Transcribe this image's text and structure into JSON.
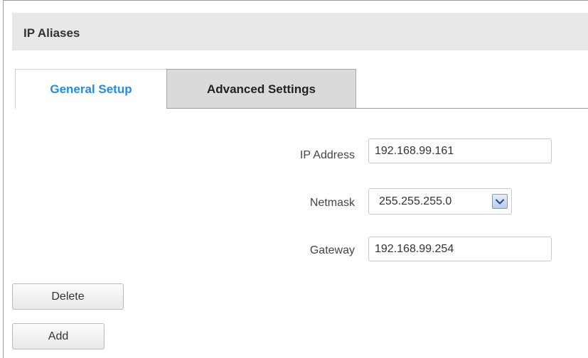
{
  "section": {
    "title": "IP Aliases"
  },
  "tabs": [
    {
      "label": "General Setup",
      "active": true
    },
    {
      "label": "Advanced Settings",
      "active": false
    }
  ],
  "form": {
    "ip_address": {
      "label": "IP Address",
      "value": "192.168.99.161"
    },
    "netmask": {
      "label": "Netmask",
      "value": "255.255.255.0",
      "icon": "chevron-down-icon"
    },
    "gateway": {
      "label": "Gateway",
      "value": "192.168.99.254"
    }
  },
  "buttons": {
    "delete_label": "Delete",
    "add_label": "Add"
  },
  "colors": {
    "active_tab_text": "#2a8ad4",
    "header_bg": "#e8e8e8",
    "inactive_tab_bg": "#dadada"
  }
}
